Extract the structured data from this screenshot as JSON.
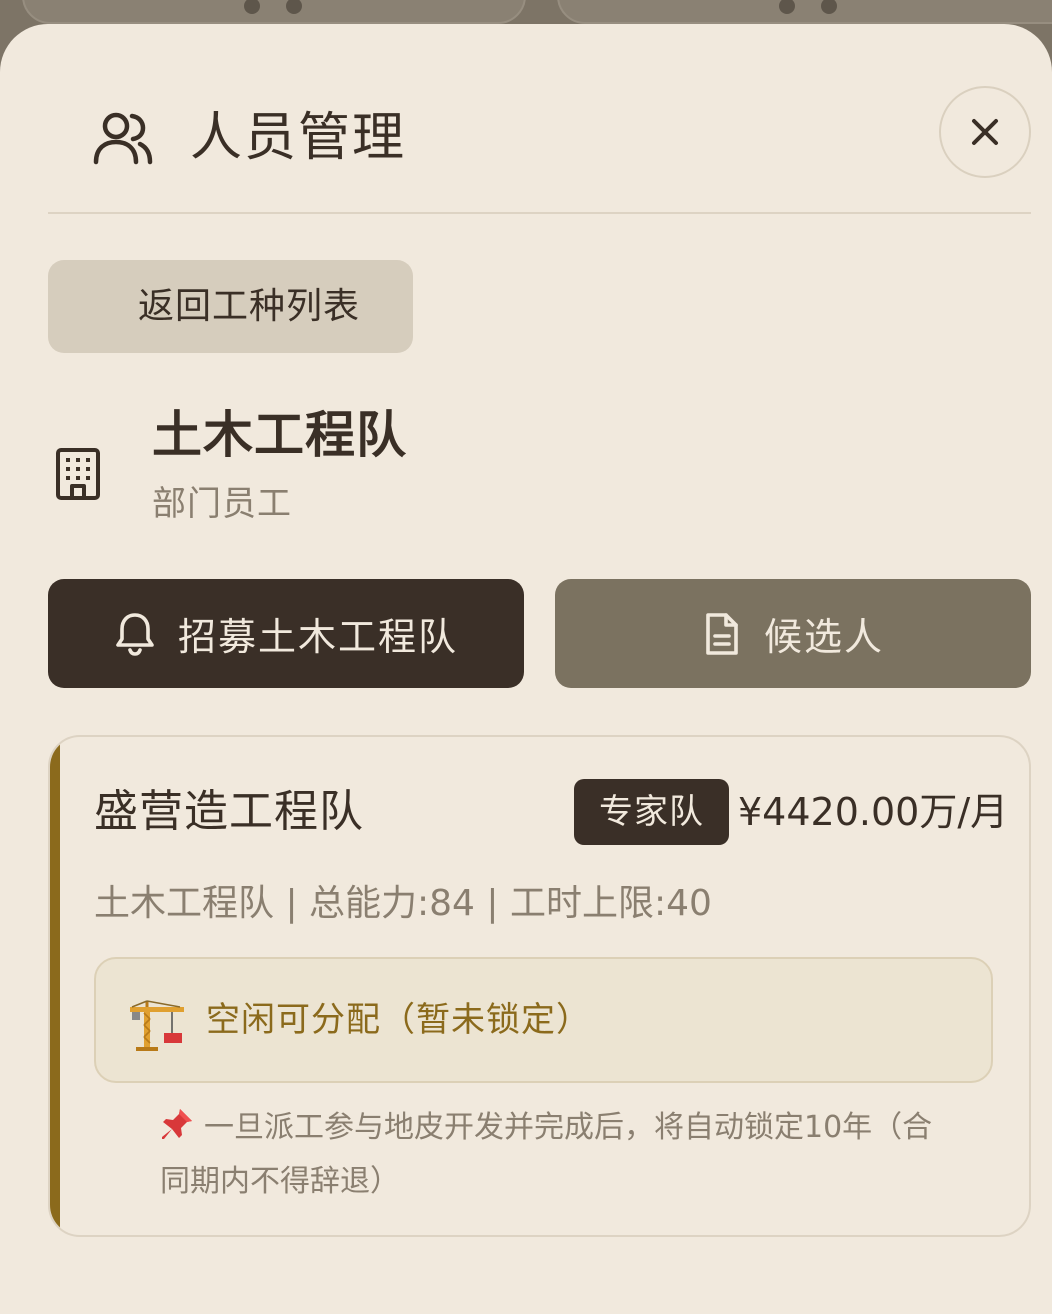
{
  "header": {
    "title": "人员管理",
    "users_icon": "users-icon",
    "close_icon": "close-icon"
  },
  "back_button": {
    "label": "返回工种列表"
  },
  "department": {
    "icon": "building-icon",
    "name": "土木工程队",
    "subtitle": "部门员工"
  },
  "actions": {
    "recruit": {
      "icon": "bell-icon",
      "label": "招募土木工程队"
    },
    "candidates": {
      "icon": "document-icon",
      "label": "候选人"
    }
  },
  "team_card": {
    "name": "盛营造工程队",
    "badge": "专家队",
    "salary": "¥4420.00万/月",
    "meta": "土木工程队 | 总能力:84 | 工时上限:40",
    "status_icon": "crane-icon",
    "status": "空闲可分配（暂未锁定）",
    "note_icon": "pin-icon",
    "note": "一旦派工参与地皮开发并完成后，将自动锁定10年（合同期内不得辞退）"
  },
  "colors": {
    "sheet_bg": "#f1e9dd",
    "dark_button": "#3a2f27",
    "muted_button": "#7b7260",
    "accent_gold": "#8b6a1c",
    "secondary_button": "#d6cdbd"
  }
}
